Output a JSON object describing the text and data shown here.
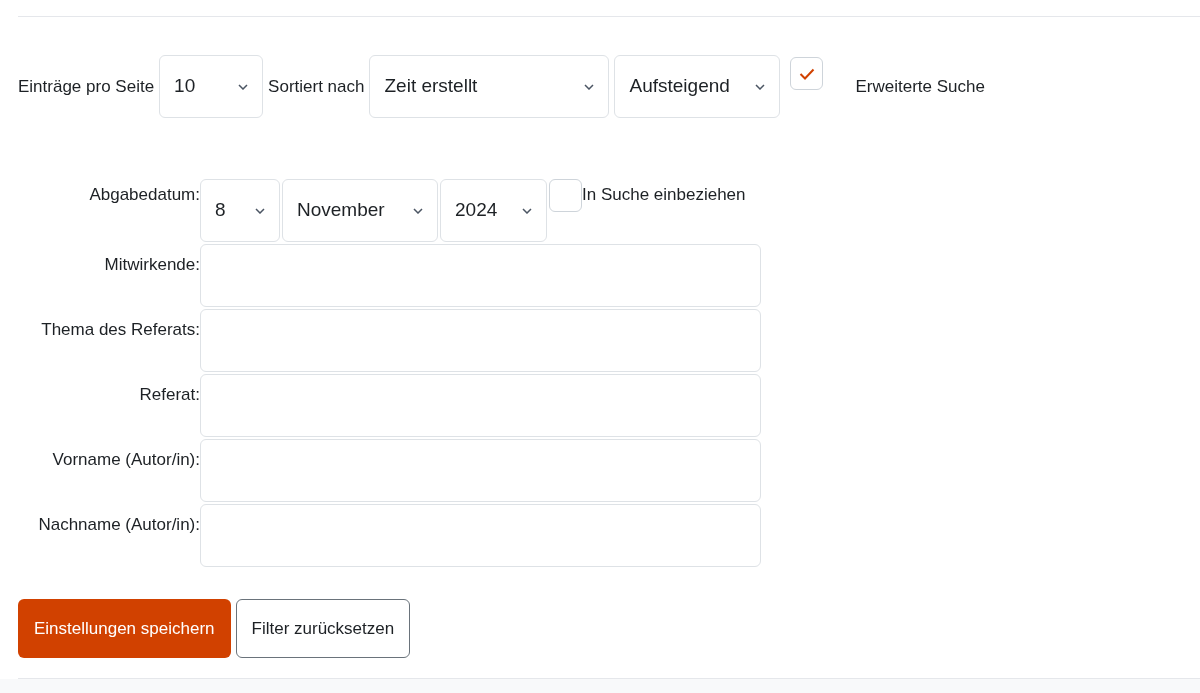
{
  "toolbar": {
    "per_page": {
      "label": "Einträge pro Seite",
      "value": "10"
    },
    "sort": {
      "label": "Sortiert nach",
      "field": "Zeit erstellt",
      "order": "Aufsteigend"
    },
    "advanced": {
      "checked": true,
      "label": "Erweiterte Suche"
    }
  },
  "date": {
    "label": "Abgabedatum:",
    "day": "8",
    "month": "November",
    "year": "2024",
    "include": {
      "label": "In Suche einbeziehen",
      "checked": false
    }
  },
  "fields": [
    {
      "label": "Mitwirkende:"
    },
    {
      "label": "Thema des Referats:"
    },
    {
      "label": "Referat:"
    },
    {
      "label": "Vorname (Autor/in):"
    },
    {
      "label": "Nachname (Autor/in):"
    }
  ],
  "buttons": [
    {
      "label": "Einstellungen speichern",
      "kind": "primary"
    },
    {
      "label": "Filter zurücksetzen",
      "kind": "secondary"
    }
  ]
}
